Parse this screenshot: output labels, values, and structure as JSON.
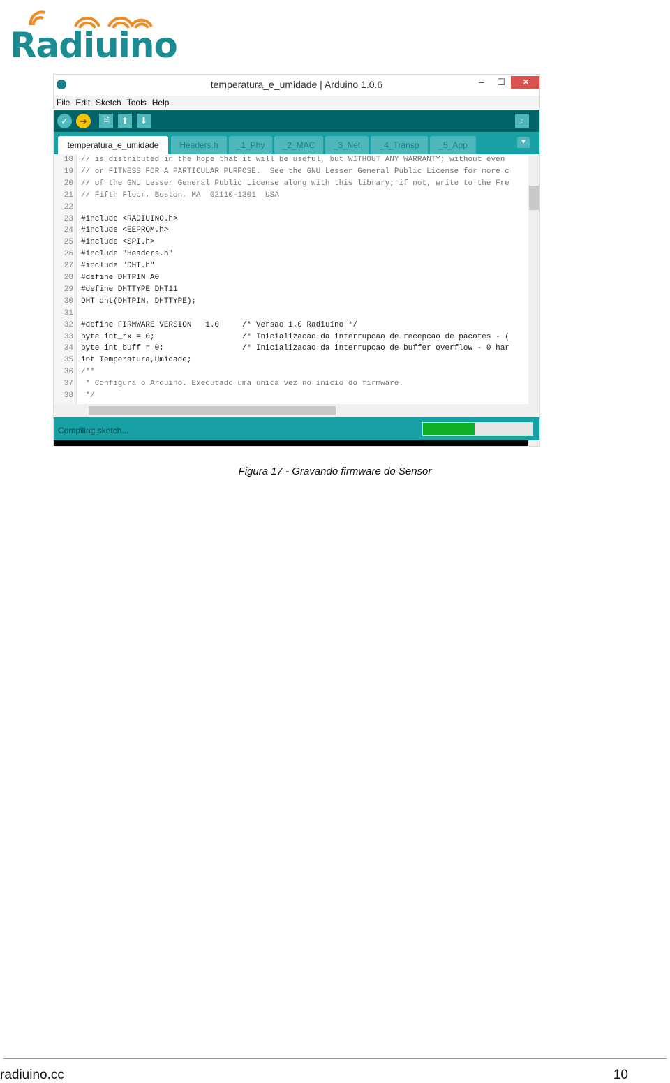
{
  "logo": {
    "text": "Radiuino",
    "colors": {
      "text": "#1a8c92",
      "arcs": "#f08a24"
    }
  },
  "window": {
    "title": "temperatura_e_umidade | Arduino 1.0.6",
    "menu": [
      "File",
      "Edit",
      "Sketch",
      "Tools",
      "Help"
    ],
    "toolbar": {
      "verify": "✓",
      "upload": "➔",
      "new": "🗎",
      "open": "⬆",
      "save": "⬇",
      "serial": "⌕"
    },
    "tabs": [
      "temperatura_e_umidade",
      "Headers.h",
      "_1_Phy",
      "_2_MAC",
      "_3_Net",
      "_4_Transp",
      "_5_App"
    ],
    "code": [
      {
        "n": "18",
        "t": "// is distributed in the hope that it will be useful, but WITHOUT ANY WARRANTY; without even",
        "c": "cm"
      },
      {
        "n": "19",
        "t": "// or FITNESS FOR A PARTICULAR PURPOSE.  See the GNU Lesser General Public License for more c",
        "c": "cm"
      },
      {
        "n": "20",
        "t": "// of the GNU Lesser General Public License along with this library; if not, write to the Fre",
        "c": "cm"
      },
      {
        "n": "21",
        "t": "// Fifth Floor, Boston, MA  02110-1301  USA",
        "c": "cm"
      },
      {
        "n": "22",
        "t": "",
        "c": ""
      },
      {
        "n": "23",
        "t": "#include <RADIUINO.h>",
        "c": ""
      },
      {
        "n": "24",
        "t": "#include <EEPROM.h>",
        "c": ""
      },
      {
        "n": "25",
        "t": "#include <SPI.h>",
        "c": ""
      },
      {
        "n": "26",
        "t": "#include \"Headers.h\"",
        "c": ""
      },
      {
        "n": "27",
        "t": "#include \"DHT.h\"",
        "c": ""
      },
      {
        "n": "28",
        "t": "#define DHTPIN A0",
        "c": ""
      },
      {
        "n": "29",
        "t": "#define DHTTYPE DHT11",
        "c": ""
      },
      {
        "n": "30",
        "t": "DHT dht(DHTPIN, DHTTYPE);",
        "c": ""
      },
      {
        "n": "31",
        "t": "",
        "c": ""
      },
      {
        "n": "32",
        "t": "#define FIRMWARE_VERSION   1.0     /* Versao 1.0 Radiuino */",
        "c": ""
      },
      {
        "n": "33",
        "t": "byte int_rx = 0;                   /* Inicializacao da interrupcao de recepcao de pacotes - (",
        "c": ""
      },
      {
        "n": "34",
        "t": "byte int_buff = 0;                 /* Inicializacao da interrupcao de buffer overflow - 0 har",
        "c": ""
      },
      {
        "n": "35",
        "t": "int Temperatura,Umidade;",
        "c": ""
      },
      {
        "n": "36",
        "t": "/**",
        "c": "cm"
      },
      {
        "n": "37",
        "t": " * Configura o Arduino. Executado uma unica vez no inicio do firmware.",
        "c": "cm"
      },
      {
        "n": "38",
        "t": " */",
        "c": "cm"
      }
    ],
    "status": "Compiling sketch...",
    "progress_percent": 47
  },
  "caption": "Figura 17 - Gravando firmware do Sensor",
  "footer": {
    "site": "radiuino.cc",
    "page": "10"
  }
}
